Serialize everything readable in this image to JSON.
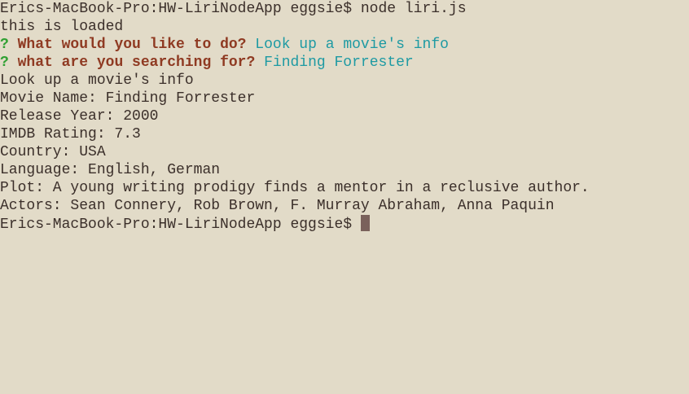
{
  "terminal": {
    "command_line": {
      "prompt": "Erics-MacBook-Pro:HW-LiriNodeApp eggsie$ ",
      "command": "node liri.js"
    },
    "output_loaded": "this is loaded",
    "question_1": {
      "mark": "?",
      "text": "What would you like to do?",
      "answer": "Look up a movie's info"
    },
    "question_2": {
      "mark": "?",
      "text": "what are you searching for?",
      "answer": "Finding Forrester"
    },
    "result_lines": [
      "Look up a movie's info",
      "Movie Name: Finding Forrester",
      "Release Year: 2000",
      "IMDB Rating: 7.3",
      "Country: USA",
      "Language: English, German",
      "Plot: A young writing prodigy finds a mentor in a reclusive author.",
      "Actors: Sean Connery, Rob Brown, F. Murray Abraham, Anna Paquin"
    ],
    "final_prompt": "Erics-MacBook-Pro:HW-LiriNodeApp eggsie$ "
  },
  "colors": {
    "background": "#e2dbc8",
    "text": "#3b2f2a",
    "question_mark": "#2fa032",
    "question_text": "#8f3a22",
    "answer_text": "#1e9aa3",
    "cursor": "#7a615b"
  }
}
